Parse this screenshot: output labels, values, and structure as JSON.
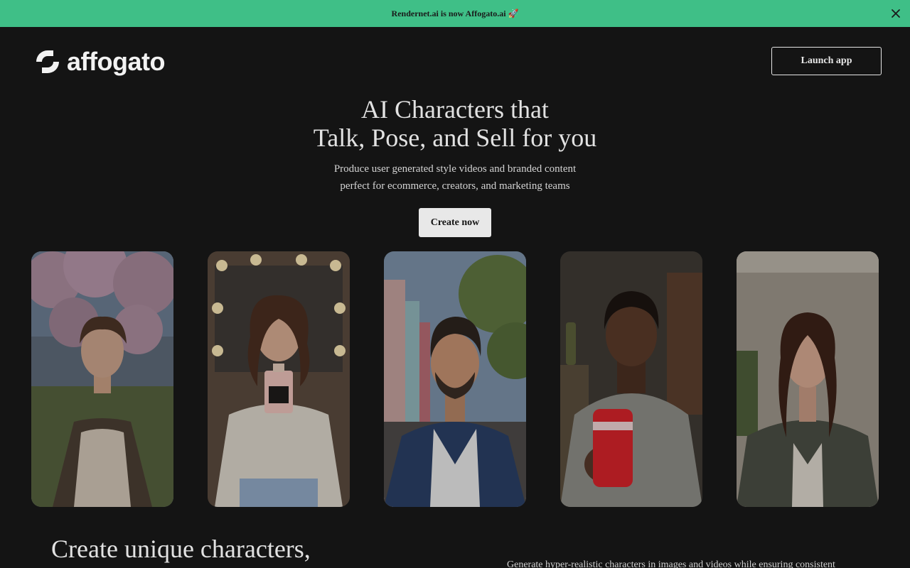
{
  "banner": {
    "text": "Rendernet.ai is now Affogato.ai 🚀",
    "close_icon": "close-icon"
  },
  "header": {
    "logo_text": "affogato",
    "logo_icon": "affogato-logo-icon",
    "launch_label": "Launch app"
  },
  "hero": {
    "title_line1": "AI Characters that",
    "title_line2": "Talk, Pose, and Sell for you",
    "subtitle_line1": "Produce user generated style videos and branded content",
    "subtitle_line2": "perfect for ecommerce, creators, and marketing teams",
    "cta_label": "Create now"
  },
  "characters": [
    {
      "name": "woman-cherry-blossoms"
    },
    {
      "name": "woman-with-perfume"
    },
    {
      "name": "man-on-street"
    },
    {
      "name": "man-with-cola"
    },
    {
      "name": "woman-indoors"
    }
  ],
  "section2": {
    "title": "Create unique characters,",
    "text": "Generate hyper-realistic characters in images and videos while ensuring consistent"
  },
  "colors": {
    "banner": "#3fbf87",
    "background": "#141414",
    "cta_bg": "#e8e8e8"
  }
}
